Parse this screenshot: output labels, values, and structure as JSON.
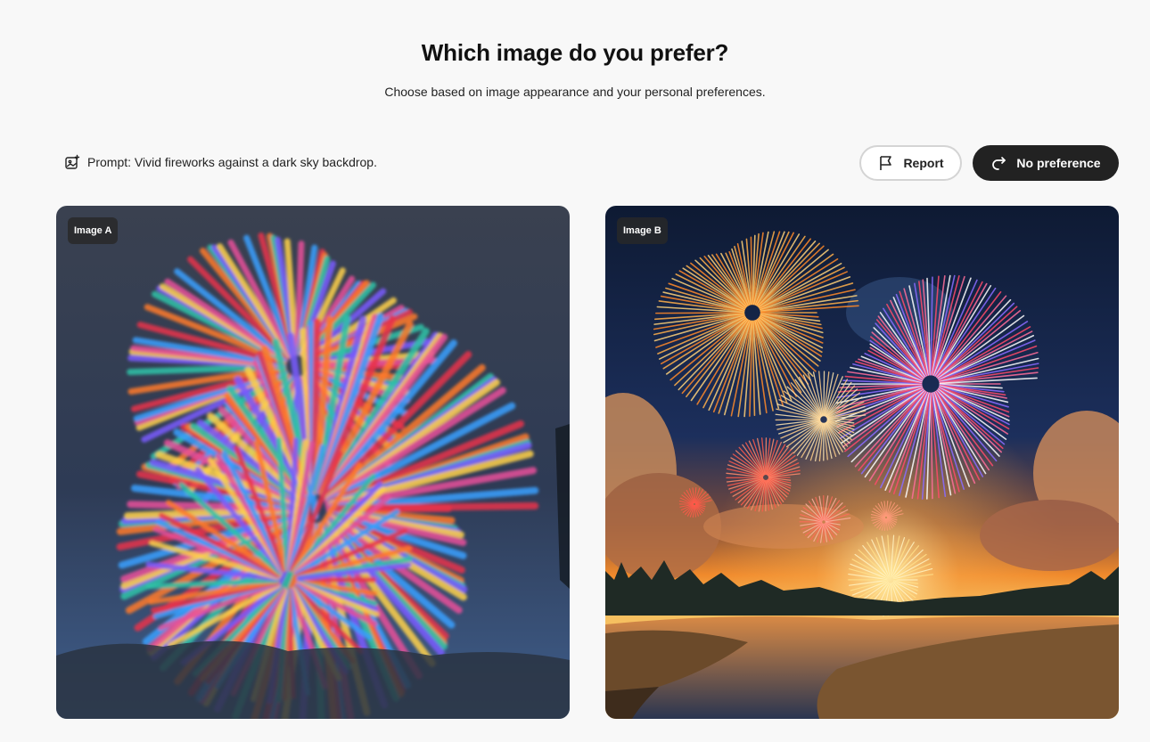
{
  "header": {
    "title": "Which image do you prefer?",
    "subtitle": "Choose based on image appearance and your personal preferences."
  },
  "prompt": {
    "icon": "image-sparkle-icon",
    "text": "Prompt: Vivid fireworks against a dark sky backdrop."
  },
  "actions": {
    "report_label": "Report",
    "report_icon": "flag-icon",
    "no_preference_label": "No preference",
    "no_preference_icon": "redo-arrow-icon"
  },
  "images": [
    {
      "badge": "Image A"
    },
    {
      "badge": "Image B"
    }
  ],
  "colors": {
    "background": "#f8f8f8",
    "primary_button": "#222222",
    "badge_bg": "#282828"
  }
}
